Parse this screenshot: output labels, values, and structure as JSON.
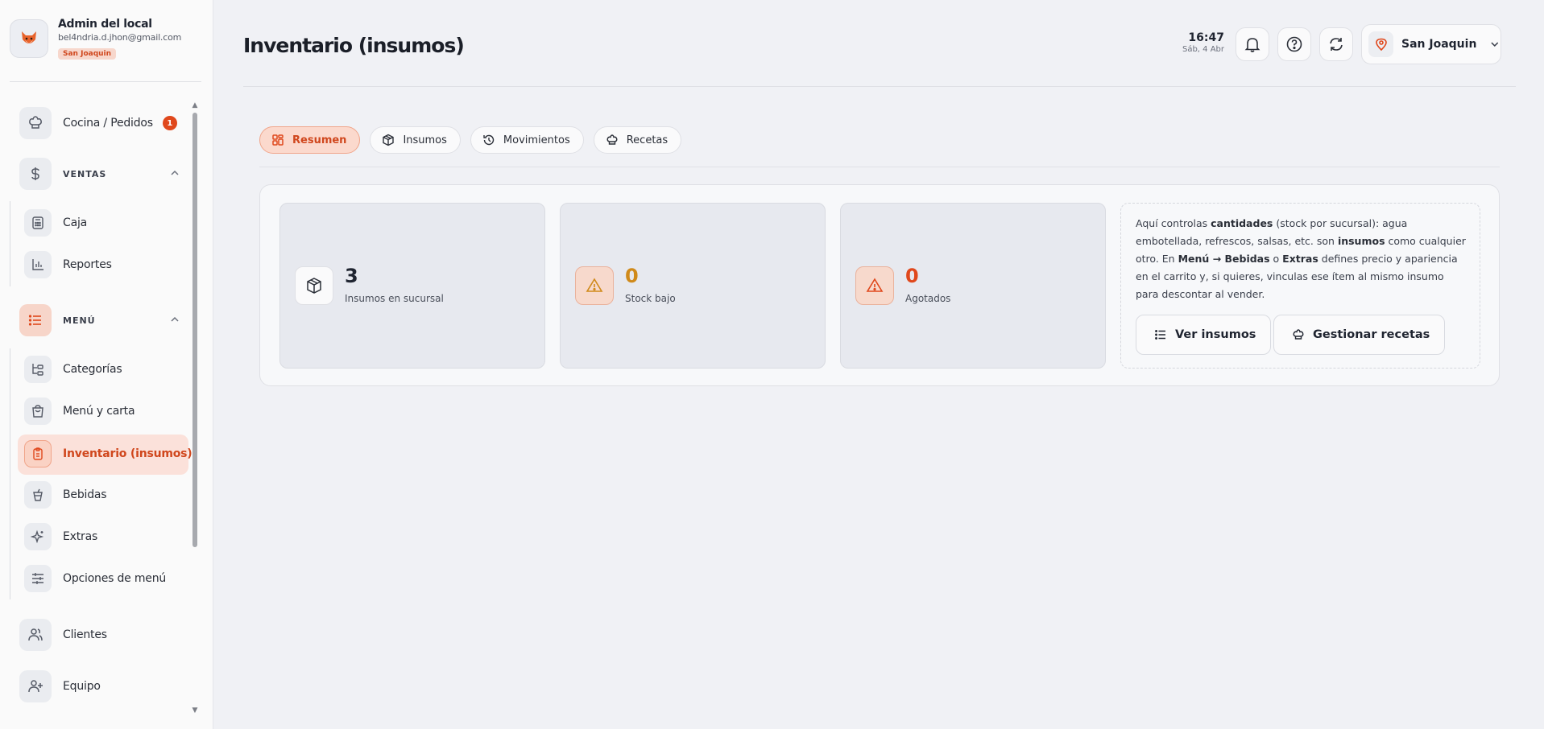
{
  "profile": {
    "name": "Admin del local",
    "email": "bel4ndria.d.jhon@gmail.com",
    "branch_badge": "San Joaquin"
  },
  "sidebar": {
    "kitchen": {
      "label": "Cocina / Pedidos",
      "badge": "1"
    },
    "ventas": {
      "label": "VENTAS",
      "items": [
        {
          "label": "Caja"
        },
        {
          "label": "Reportes"
        }
      ]
    },
    "menu": {
      "label": "MENÚ",
      "items": [
        {
          "label": "Categorías"
        },
        {
          "label": "Menú y carta"
        },
        {
          "label": "Inventario (insumos)"
        },
        {
          "label": "Bebidas"
        },
        {
          "label": "Extras"
        },
        {
          "label": "Opciones de menú"
        }
      ]
    },
    "clientes": {
      "label": "Clientes"
    },
    "equipo": {
      "label": "Equipo"
    }
  },
  "header": {
    "title": "Inventario (insumos)",
    "time": "16:47",
    "date": "Sáb, 4 Abr",
    "branch": "San Joaquin"
  },
  "tabs": [
    {
      "label": "Resumen",
      "active": true
    },
    {
      "label": "Insumos",
      "active": false
    },
    {
      "label": "Movimientos",
      "active": false
    },
    {
      "label": "Recetas",
      "active": false
    }
  ],
  "stats": [
    {
      "value": "3",
      "label": "Insumos en sucursal"
    },
    {
      "value": "0",
      "label": "Stock bajo"
    },
    {
      "value": "0",
      "label": "Agotados"
    }
  ],
  "info": {
    "t1": "Aquí controlas ",
    "b1": "cantidades",
    "t2": " (stock por sucursal): agua embotellada, refrescos, salsas, etc. son ",
    "b2": "insumos",
    "t3": " como cualquier otro. En ",
    "b3": "Menú → Bebidas",
    "t4": " o ",
    "b4": "Extras",
    "t5": " defines precio y apariencia en el carrito y, si quieres, vinculas ese ítem al mismo insumo para descontar al vender.",
    "btn_ver": "Ver insumos",
    "btn_recetas": "Gestionar recetas"
  },
  "colors": {
    "accent": "#e0481c",
    "accent_soft": "#fbd9cd",
    "warning": "#d08a1a"
  }
}
